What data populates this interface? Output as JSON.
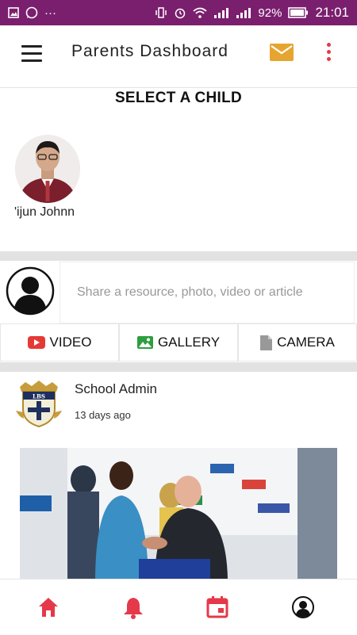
{
  "status_bar": {
    "signal_text": "···",
    "battery": "92%",
    "time": "21:01"
  },
  "app_bar": {
    "title": "Parents Dashboard",
    "icons": [
      "hamburger-icon",
      "mail-icon",
      "more-vert-icon"
    ]
  },
  "select_child": {
    "heading": "SELECT A CHILD",
    "children": [
      {
        "name": "'ijun Johnn"
      }
    ]
  },
  "share": {
    "placeholder": "Share a resource, photo, video or article",
    "actions": [
      {
        "label": "VIDEO",
        "icon": "youtube-icon"
      },
      {
        "label": "GALLERY",
        "icon": "gallery-icon"
      },
      {
        "label": "CAMERA",
        "icon": "document-icon"
      }
    ]
  },
  "post": {
    "author": "School Admin",
    "time": "13 days ago",
    "logo_text": "LBS"
  },
  "bottom_nav": {
    "items": [
      "home-icon",
      "bell-icon",
      "calendar-icon",
      "profile-icon"
    ],
    "accent": "#e53949"
  },
  "colors": {
    "status_bar": "#7a1f6e",
    "accent": "#e53949",
    "mail": "#e6a531"
  }
}
